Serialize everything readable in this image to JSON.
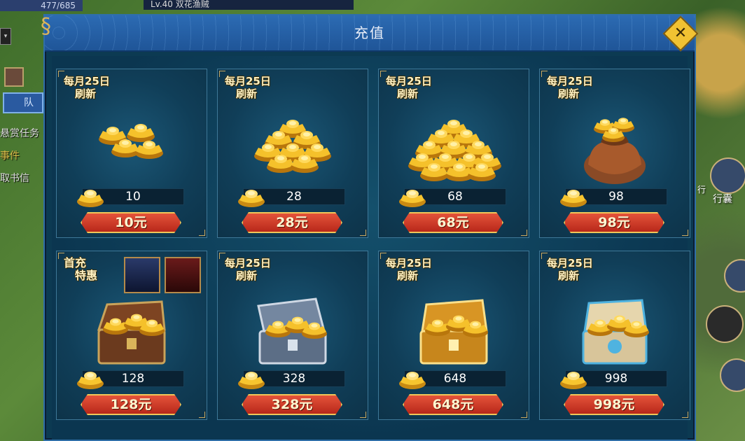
{
  "hud": {
    "hp_text": "477/685",
    "target_text": "Lv.40 双花渔贼",
    "team_tab": "队",
    "side_links": [
      "悬赏任务",
      "事件",
      "取书信"
    ],
    "right_labels": [
      "行囊",
      "行"
    ]
  },
  "modal": {
    "title": "充值",
    "close_label": "✕"
  },
  "cards": [
    {
      "tag_line1": "每月25日",
      "tag_line2": "刷新",
      "art": "ingot-small-pile",
      "amount": "10",
      "price": "10元"
    },
    {
      "tag_line1": "每月25日",
      "tag_line2": "刷新",
      "art": "ingot-medium-pile",
      "amount": "28",
      "price": "28元"
    },
    {
      "tag_line1": "每月25日",
      "tag_line2": "刷新",
      "art": "ingot-large-pile",
      "amount": "68",
      "price": "68元"
    },
    {
      "tag_line1": "每月25日",
      "tag_line2": "刷新",
      "art": "ingot-bag",
      "amount": "98",
      "price": "98元"
    },
    {
      "tag_line1": "首充",
      "tag_line2": "特惠",
      "art": "wooden-chest",
      "amount": "128",
      "price": "128元",
      "promo_icons": [
        "armor-icon",
        "bow-icon"
      ]
    },
    {
      "tag_line1": "每月25日",
      "tag_line2": "刷新",
      "art": "silver-chest",
      "amount": "328",
      "price": "328元"
    },
    {
      "tag_line1": "每月25日",
      "tag_line2": "刷新",
      "art": "gold-chest",
      "amount": "648",
      "price": "648元"
    },
    {
      "tag_line1": "每月25日",
      "tag_line2": "刷新",
      "art": "jade-chest",
      "amount": "998",
      "price": "998元"
    }
  ],
  "colors": {
    "panel": "#0c3a52",
    "header": "#2c6bb3",
    "price_button": "#c8321f",
    "gold": "#f0c659"
  }
}
